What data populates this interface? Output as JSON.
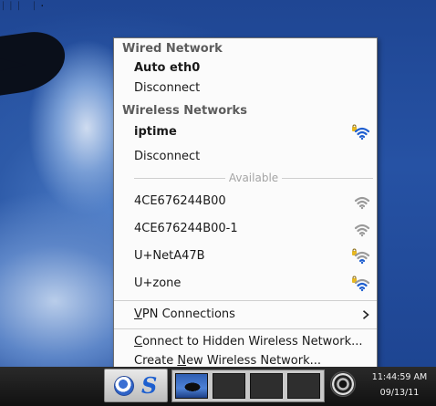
{
  "desktop": {
    "top_marks": "ᛁᛁᛁ ᛁ·"
  },
  "menu": {
    "wired_title": "Wired Network",
    "wired_connection": "Auto eth0",
    "wired_disconnect": "Disconnect",
    "wireless_title": "Wireless Networks",
    "wireless_connection": "iptime",
    "wireless_disconnect": "Disconnect",
    "available_label": "Available",
    "networks": [
      {
        "ssid": "4CE676244B00",
        "secured": false,
        "icon": "wifi-signal-icon"
      },
      {
        "ssid": "4CE676244B00-1",
        "secured": false,
        "icon": "wifi-signal-icon"
      },
      {
        "ssid": "U+NetA47B",
        "secured": true,
        "icon": "wifi-lock-signal-icon"
      },
      {
        "ssid": "U+zone",
        "secured": true,
        "icon": "wifi-lock-signal-icon"
      }
    ],
    "vpn_label_first": "V",
    "vpn_label_rest": "PN Connections",
    "hidden_label_first": "C",
    "hidden_label_rest": "onnect to Hidden Wireless Network...",
    "create_label_prefix": "Create ",
    "create_label_u": "N",
    "create_label_rest": "ew Wireless Network..."
  },
  "taskbar": {
    "clock_time": "11:44:59 AM",
    "clock_date": "09/13/11"
  },
  "colors": {
    "wifi_blue": "#1f5fd0",
    "wifi_grey": "#9a9a9a",
    "lock_yellow": "#e8b820",
    "menu_bg": "#fbfbfb",
    "section_title": "#5c5c5c"
  }
}
